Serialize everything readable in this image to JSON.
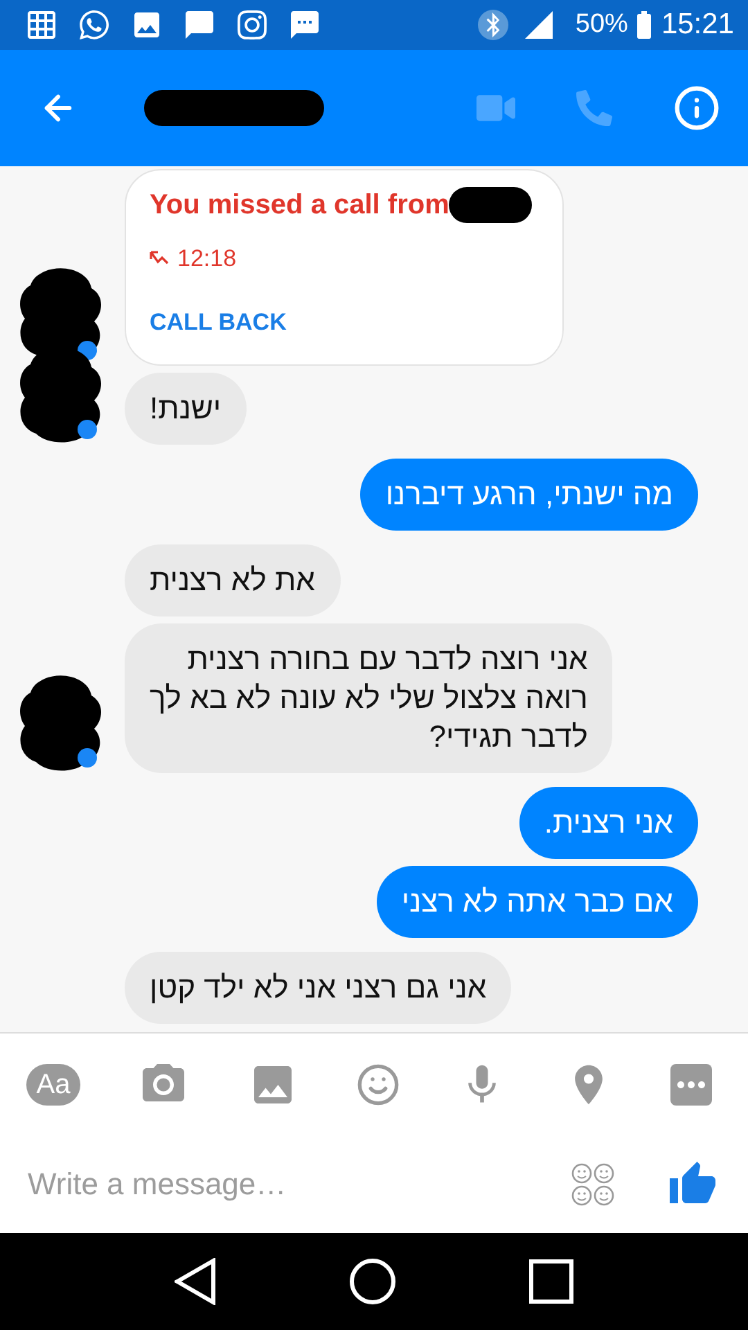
{
  "status_bar": {
    "battery": "50%",
    "time": "15:21"
  },
  "messages": [
    {
      "kind": "call",
      "title": "You missed a call from",
      "time": "12:18",
      "action": "CALL BACK",
      "avatar": true
    },
    {
      "kind": "incoming",
      "text": "ישנת!",
      "avatar": true
    },
    {
      "kind": "outgoing",
      "text": "מה ישנתי, הרגע דיברנו"
    },
    {
      "kind": "incoming",
      "text": "את לא רצנית",
      "avatar": false
    },
    {
      "kind": "incoming",
      "text": "אני רוצה לדבר עם בחורה רצנית\nרואה צלצול שלי לא עונה לא בא לך\nלדבר תגידי?",
      "avatar": true
    },
    {
      "kind": "outgoing",
      "text": "אני רצנית."
    },
    {
      "kind": "outgoing",
      "text": "אם כבר אתה לא רצני"
    },
    {
      "kind": "incoming",
      "text": "אני גם רצני אני לא ילד קטן",
      "avatar": false
    }
  ],
  "composer": {
    "text_button": "Aa",
    "placeholder": "Write a message…"
  }
}
